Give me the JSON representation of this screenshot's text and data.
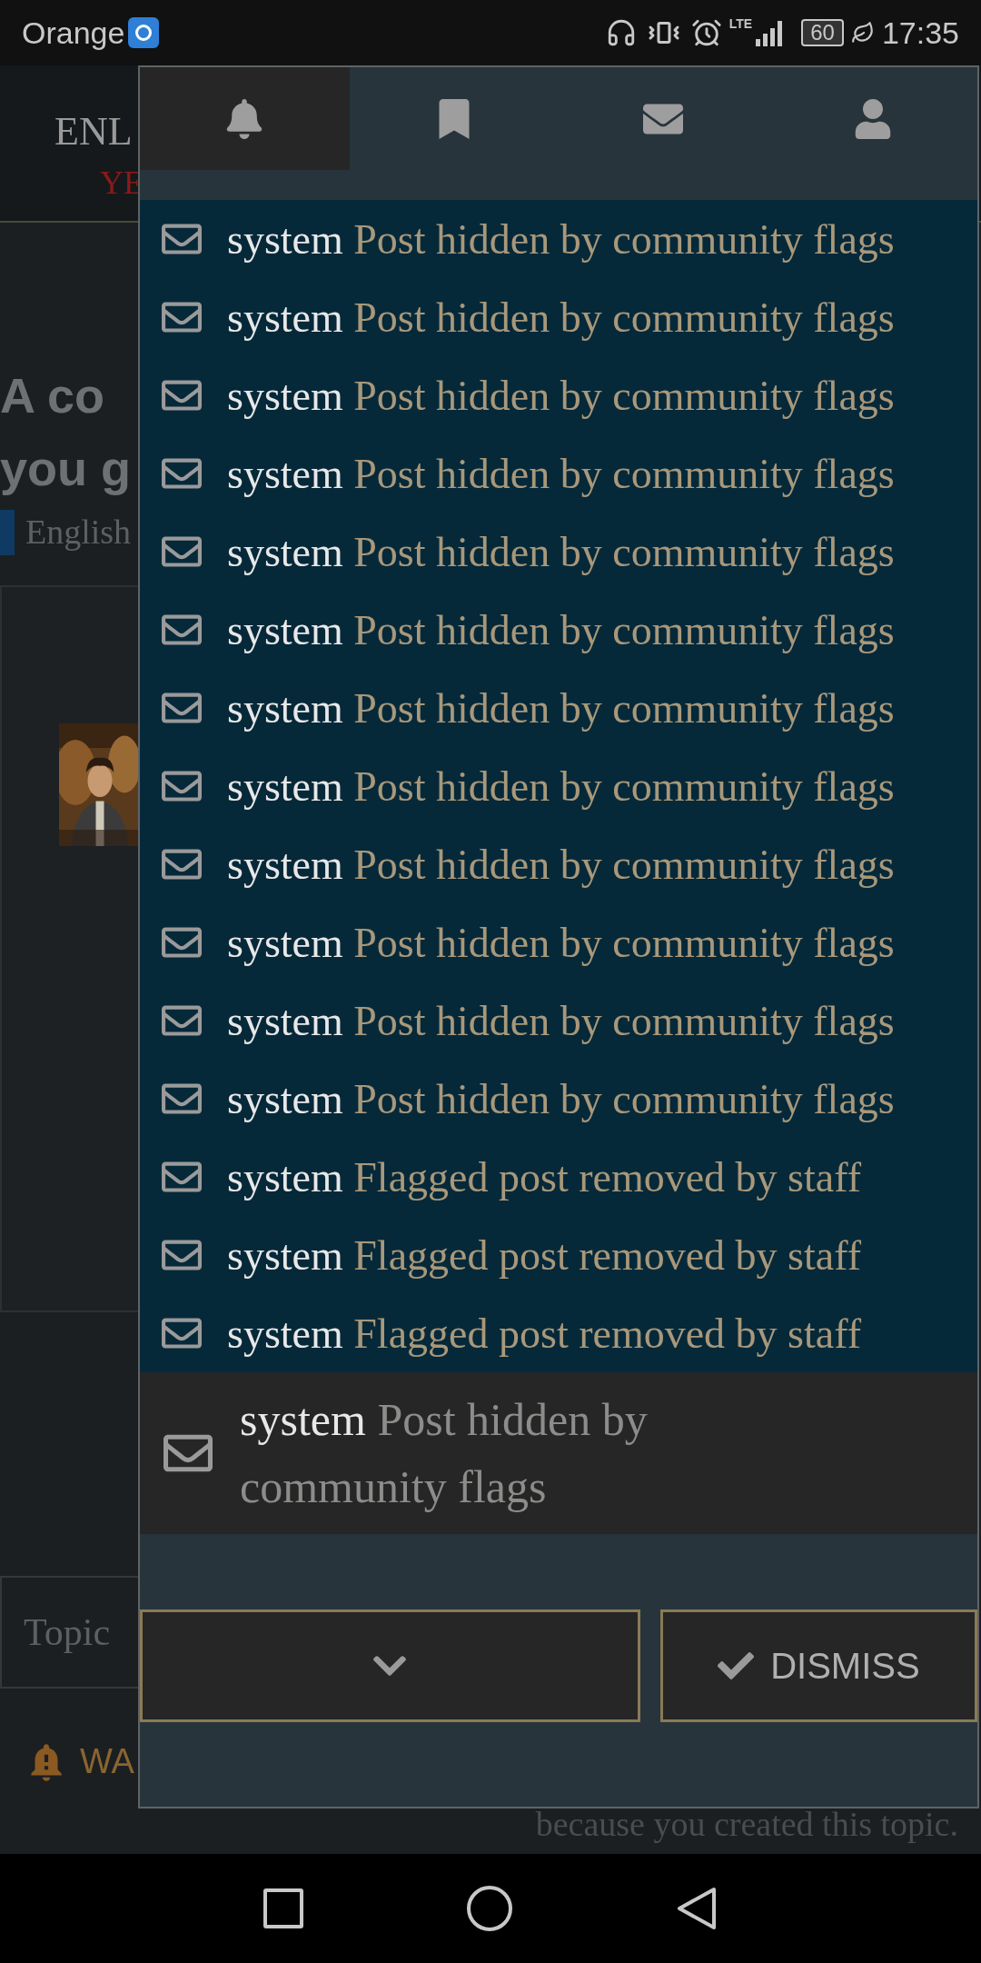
{
  "status_bar": {
    "carrier": "Orange",
    "network": "LTE",
    "battery": "60",
    "time": "17:35"
  },
  "background_page": {
    "logo": {
      "text_top": "ENL",
      "text_bottom": "YE"
    },
    "title_lines": [
      "A co",
      "you g"
    ],
    "category": "English",
    "topic_box": "Topic",
    "warning": "WA",
    "notice": "because you created this topic."
  },
  "panel": {
    "tabs": [
      {
        "selected": true
      },
      {
        "selected": false
      },
      {
        "selected": false
      },
      {
        "selected": false
      }
    ],
    "notifications": [
      {
        "user": "system",
        "message": "Post hidden by community flags",
        "selected": false
      },
      {
        "user": "system",
        "message": "Post hidden by community flags",
        "selected": false
      },
      {
        "user": "system",
        "message": "Post hidden by community flags",
        "selected": false
      },
      {
        "user": "system",
        "message": "Post hidden by community flags",
        "selected": false
      },
      {
        "user": "system",
        "message": "Post hidden by community flags",
        "selected": false
      },
      {
        "user": "system",
        "message": "Post hidden by community flags",
        "selected": false
      },
      {
        "user": "system",
        "message": "Post hidden by community flags",
        "selected": false
      },
      {
        "user": "system",
        "message": "Post hidden by community flags",
        "selected": false
      },
      {
        "user": "system",
        "message": "Post hidden by community flags",
        "selected": false
      },
      {
        "user": "system",
        "message": "Post hidden by community flags",
        "selected": false
      },
      {
        "user": "system",
        "message": "Post hidden by community flags",
        "selected": false
      },
      {
        "user": "system",
        "message": "Post hidden by community flags",
        "selected": false
      },
      {
        "user": "system",
        "message": "Flagged post removed by staff",
        "selected": false
      },
      {
        "user": "system",
        "message": "Flagged post removed by staff",
        "selected": false
      },
      {
        "user": "system",
        "message": "Flagged post removed by staff",
        "selected": false
      },
      {
        "user": "system",
        "message": "Post hidden by community flags",
        "selected": true
      }
    ],
    "dismiss_label": "DISMISS"
  }
}
